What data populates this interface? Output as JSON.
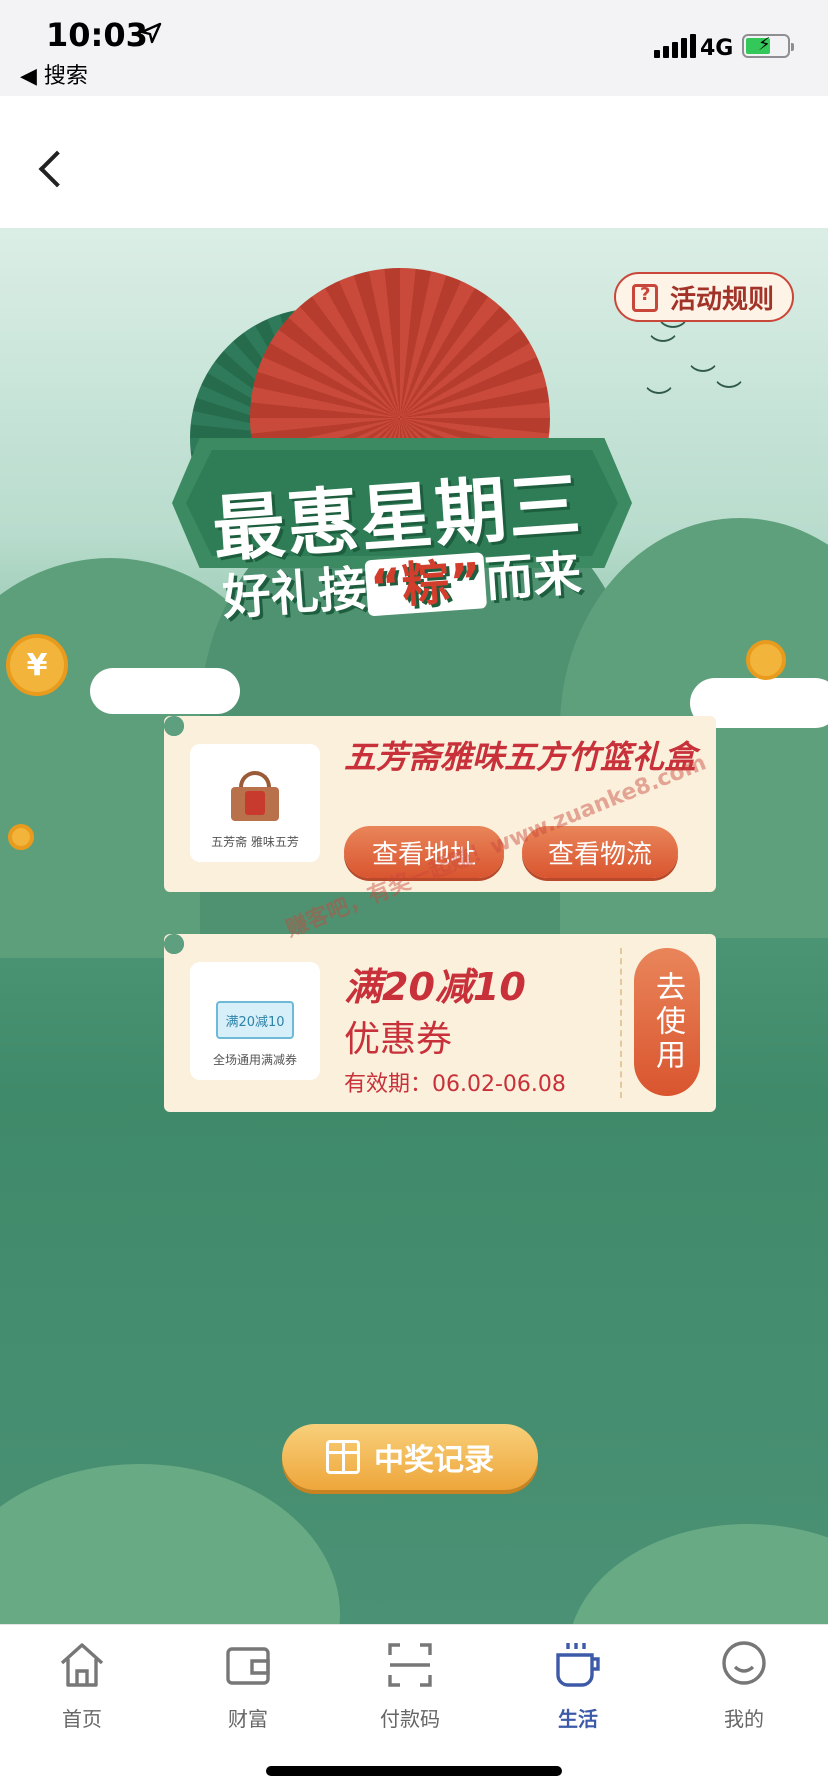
{
  "status": {
    "time": "10:03",
    "back_app": "◀ 搜索",
    "network": "4G"
  },
  "activity": {
    "rules_label": "活动规则",
    "title_line1": "最惠星期三",
    "title_line2_pre": "好礼接",
    "title_line2_hl": "“粽”",
    "title_line2_post": "而来",
    "coin_symbol": "¥"
  },
  "prize_card": {
    "thumb_label": "五芳斋 雅味五芳",
    "title": "五芳斋雅味五方竹篮礼盒",
    "address_button": "查看地址",
    "logistics_button": "查看物流"
  },
  "coupon_card": {
    "thumb_coupon_text": "满20减10",
    "thumb_label": "全场通用满减券",
    "title": "满20减10",
    "subtitle": "优惠券",
    "validity": "有效期：06.02-06.08",
    "use_button": "去使用"
  },
  "watermark": "赚客吧，有奖一起赚！www.zuanke8.com",
  "record_button": "中奖记录",
  "tabbar": {
    "items": [
      {
        "label": "首页",
        "icon": "home-icon"
      },
      {
        "label": "财富",
        "icon": "wallet-icon"
      },
      {
        "label": "付款码",
        "icon": "scan-icon"
      },
      {
        "label": "生活",
        "icon": "coffee-cup-icon"
      },
      {
        "label": "我的",
        "icon": "smile-face-icon"
      }
    ],
    "active_index": 3
  },
  "colors": {
    "accent_red": "#c8303a",
    "button_orange": "#d9552f",
    "active_tab": "#3d5aa8",
    "card_bg": "#fbf0dc"
  }
}
